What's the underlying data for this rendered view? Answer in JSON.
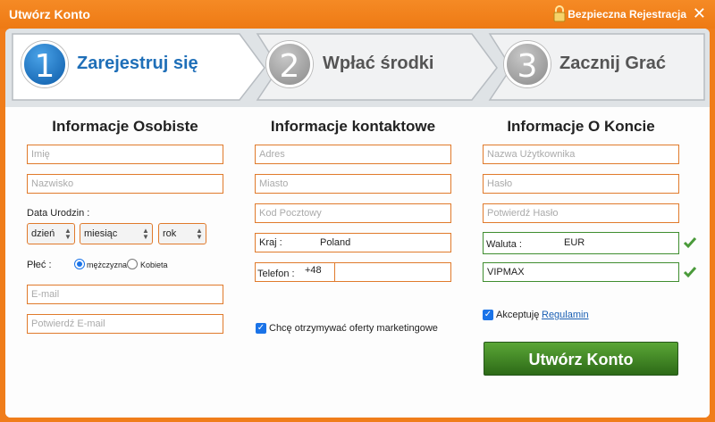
{
  "header": {
    "title": "Utwórz Konto",
    "secure_label": "Bezpieczna Rejestracja",
    "close_symbol": "✕"
  },
  "steps": [
    {
      "number": "1",
      "label": "Zarejestruj się"
    },
    {
      "number": "2",
      "label": "Wpłać środki"
    },
    {
      "number": "3",
      "label": "Zacznij Grać"
    }
  ],
  "personal": {
    "title": "Informacje Osobiste",
    "first_name_placeholder": "Imię",
    "last_name_placeholder": "Nazwisko",
    "dob_label": "Data Urodzin :",
    "day": "dzień",
    "month": "miesiąc",
    "year": "rok",
    "gender_label": "Płeć :",
    "male": "mężczyzna",
    "female": "Kobieta",
    "email_placeholder": "E-mail",
    "email_confirm_placeholder": "Potwierdź E-mail"
  },
  "contact": {
    "title": "Informacje kontaktowe",
    "address_placeholder": "Adres",
    "city_placeholder": "Miasto",
    "postal_placeholder": "Kod Pocztowy",
    "country_label": "Kraj :",
    "country_value": "Poland",
    "phone_label": "Telefon :",
    "phone_prefix": "+48",
    "marketing_label": "Chcę otrzymywać oferty marketingowe"
  },
  "account": {
    "title": "Informacje O Koncie",
    "username_placeholder": "Nazwa Użytkownika",
    "password_placeholder": "Hasło",
    "password_confirm_placeholder": "Potwierdź Hasło",
    "currency_label": "Waluta :",
    "currency_value": "EUR",
    "promo_value": "VIPMAX",
    "accept_label": "Akceptuję",
    "terms_link": "Regulamin",
    "submit_label": "Utwórz Konto"
  },
  "colors": {
    "accent_orange": "#f07d1a",
    "step_active_blue": "#1f6fb8",
    "submit_green": "#3f8d2f",
    "field_border": "#e07a2b"
  }
}
